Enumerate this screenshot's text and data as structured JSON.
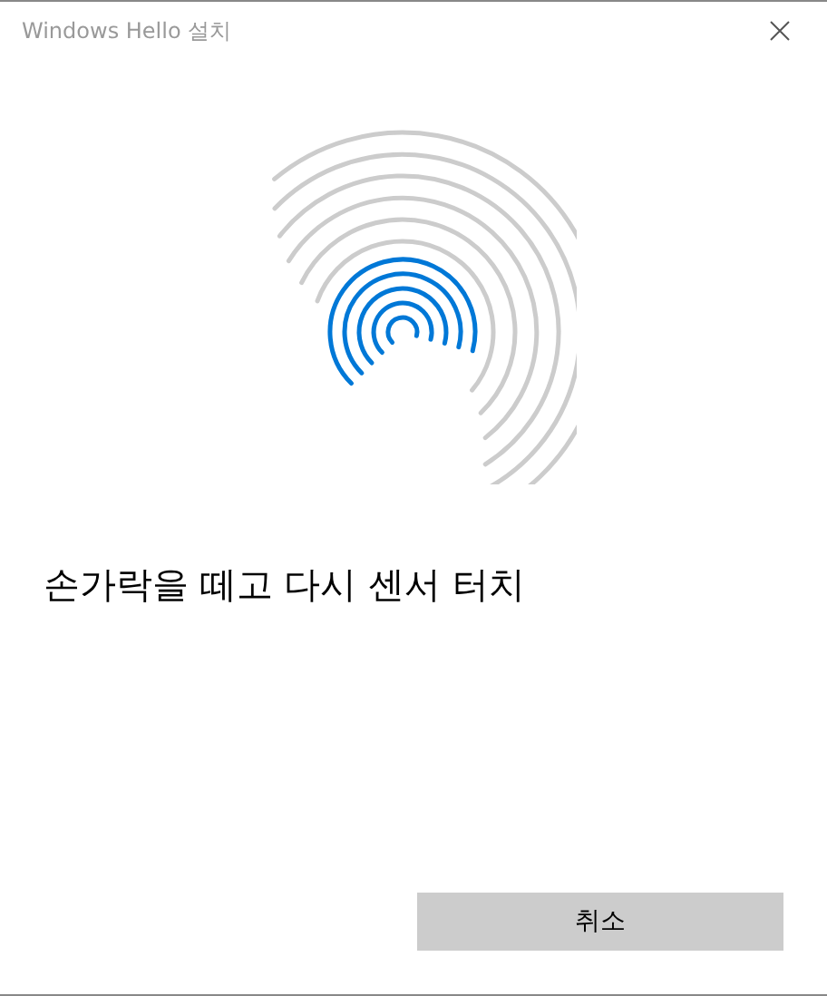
{
  "window": {
    "title": "Windows Hello 설치"
  },
  "message": "손가락을 떼고 다시 센서 터치",
  "buttons": [
    {
      "label": "취소"
    }
  ]
}
